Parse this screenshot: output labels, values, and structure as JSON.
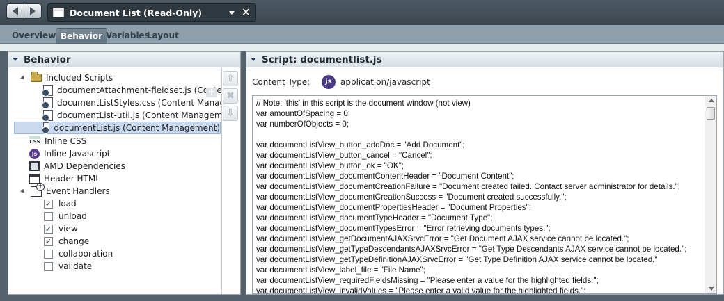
{
  "header": {
    "document_title": "Document List (Read-Only)",
    "close_glyph": "✕"
  },
  "tabs": [
    {
      "label": "Overview"
    },
    {
      "label": "Behavior"
    },
    {
      "label": "Variables"
    },
    {
      "label": "Layout"
    }
  ],
  "behavior_panel": {
    "title": "Behavior",
    "tree": {
      "included_scripts": "Included Scripts",
      "scripts": [
        "documentAttachment-fieldset.js (Content M",
        "documentListStyles.css (Content Manageme",
        "documentList-util.js (Content Management",
        "documentList.js (Content Management)"
      ],
      "inline_css": "Inline CSS",
      "inline_javascript": "Inline Javascript",
      "amd_dependencies": "AMD Dependencies",
      "header_html": "Header HTML",
      "event_handlers": "Event Handlers",
      "events": [
        {
          "label": "load",
          "checked": true
        },
        {
          "label": "unload",
          "checked": false
        },
        {
          "label": "view",
          "checked": true
        },
        {
          "label": "change",
          "checked": true
        },
        {
          "label": "collaboration",
          "checked": false
        },
        {
          "label": "validate",
          "checked": false
        }
      ]
    }
  },
  "script_panel": {
    "title": "Script: documentlist.js",
    "content_type_label": "Content Type:",
    "content_type_value": "application/javascript",
    "js_badge": "js",
    "code_lines": [
      "// Note: 'this' in this script is the document window (not view)",
      "var amountOfSpacing = 0;",
      "var numberOfObjects = 0;",
      "",
      "var documentListView_button_addDoc = \"Add Document\";",
      "var documentListView_button_cancel = \"Cancel\";",
      "var documentListView_button_ok = \"OK\";",
      "var documentListView_documentContentHeader = \"Document Content\";",
      "var documentListView_documentCreationFailure = \"Document created failed. Contact server administrator for details.\";",
      "var documentListView_documentCreationSuccess = \"Document created successfully.\";",
      "var documentListView_documentPropertiesHeader = \"Document Properties\";",
      "var documentListView_documentTypeHeader = \"Document Type\";",
      "var documentListView_documentTypesError = \"Error retrieving documents types.\";",
      "var documentListView_getDocumentAJAXSrvcError = \"Get Document AJAX service cannot be located.\";",
      "var documentListView_getTypeDescendantsAJAXSrvcError = \"Get Type Descendants AJAX service cannot be located.\";",
      "var documentListView_getTypeDefinitionAJAXSrvcError = \"Get Type Definition AJAX service cannot be located.\"",
      "var documentListView_label_file = \"File Name\";",
      "var documentListView_requiredFieldsMissing = \"Please enter a value for the highlighted fields.\";",
      "var documentListView_invalidValues = \"Please enter a valid value for the highlighted fields.\";"
    ]
  }
}
